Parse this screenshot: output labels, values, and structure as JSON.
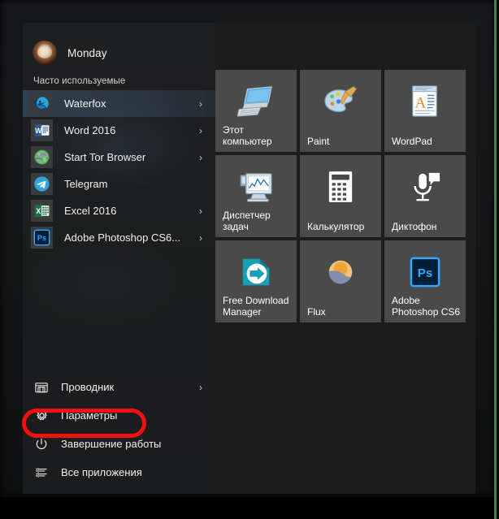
{
  "desktop": {
    "background_color": "#0f1011",
    "edge_accent_color": "#4e7a52"
  },
  "start_menu": {
    "background_color": "#1c1c1c",
    "user": {
      "name": "Monday",
      "avatar_icon": "user-avatar-coffee-cup"
    },
    "section_label": "Часто используемые",
    "apps": [
      {
        "label": "Waterfox",
        "icon": "waterfox-icon",
        "has_chevron": true,
        "highlighted": true
      },
      {
        "label": "Word 2016",
        "icon": "word-icon",
        "has_chevron": true,
        "highlighted": false
      },
      {
        "label": "Start Tor Browser",
        "icon": "tor-icon",
        "has_chevron": true,
        "highlighted": false
      },
      {
        "label": "Telegram",
        "icon": "telegram-icon",
        "has_chevron": false,
        "highlighted": false
      },
      {
        "label": "Excel 2016",
        "icon": "excel-icon",
        "has_chevron": true,
        "highlighted": false
      },
      {
        "label": "Adobe Photoshop CS6...",
        "icon": "photoshop-icon",
        "has_chevron": true,
        "highlighted": false
      }
    ],
    "bottom_nav": [
      {
        "label": "Проводник",
        "icon": "file-explorer-icon",
        "has_chevron": true,
        "highlighted": false
      },
      {
        "label": "Параметры",
        "icon": "gear-icon",
        "has_chevron": false,
        "highlighted": true
      },
      {
        "label": "Завершение работы",
        "icon": "power-icon",
        "has_chevron": false,
        "highlighted": false
      },
      {
        "label": "Все приложения",
        "icon": "all-apps-list-icon",
        "has_chevron": false,
        "highlighted": false
      }
    ],
    "annotation": {
      "target": "Параметры",
      "shape": "rounded-rectangle",
      "color": "#f2110f"
    },
    "tiles": [
      {
        "label": "Этот компьютер",
        "icon": "this-pc-icon",
        "color": "#4a4a4a"
      },
      {
        "label": "Paint",
        "icon": "paint-palette-icon",
        "color": "#4a4a4a"
      },
      {
        "label": "WordPad",
        "icon": "wordpad-icon",
        "color": "#4a4a4a"
      },
      {
        "label": "Диспетчер задач",
        "icon": "task-manager-icon",
        "color": "#4a4a4a"
      },
      {
        "label": "Калькулятор",
        "icon": "calculator-icon",
        "color": "#4a4a4a"
      },
      {
        "label": "Диктофон",
        "icon": "voice-recorder-icon",
        "color": "#4a4a4a"
      },
      {
        "label": "Free Download Manager",
        "icon": "fdm-icon",
        "color": "#4a4a4a"
      },
      {
        "label": "Flux",
        "icon": "flux-icon",
        "color": "#4a4a4a"
      },
      {
        "label": "Adobe Photoshop CS6",
        "icon": "photoshop-icon",
        "color": "#4a4a4a"
      }
    ]
  }
}
